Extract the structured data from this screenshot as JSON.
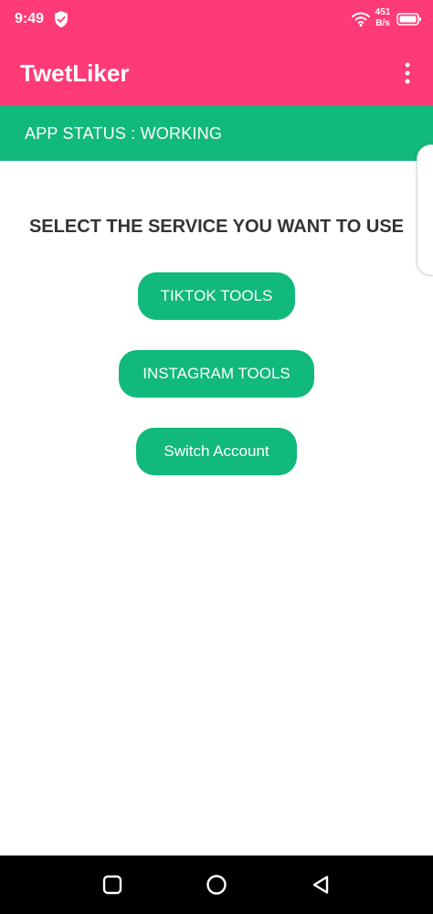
{
  "status_bar": {
    "time": "9:49",
    "network_speed_value": "451",
    "network_speed_unit": "B/s",
    "icons": [
      "shield-icon",
      "wifi-icon",
      "battery-icon"
    ]
  },
  "app_bar": {
    "title": "TwetLiker",
    "menu_icon": "more-vert-icon"
  },
  "banner": {
    "text": "APP STATUS : WORKING"
  },
  "main": {
    "heading": "SELECT THE SERVICE YOU WANT TO USE",
    "buttons": [
      {
        "label": "TIKTOK TOOLS"
      },
      {
        "label": "INSTAGRAM TOOLS"
      },
      {
        "label": "Switch Account"
      }
    ]
  },
  "nav_bar": {
    "icons": [
      "recents-square-icon",
      "home-circle-icon",
      "back-triangle-icon"
    ]
  },
  "colors": {
    "primary": "#ff3b77",
    "accent": "#11b97a",
    "text_dark": "#333333",
    "nav_background": "#000000"
  }
}
